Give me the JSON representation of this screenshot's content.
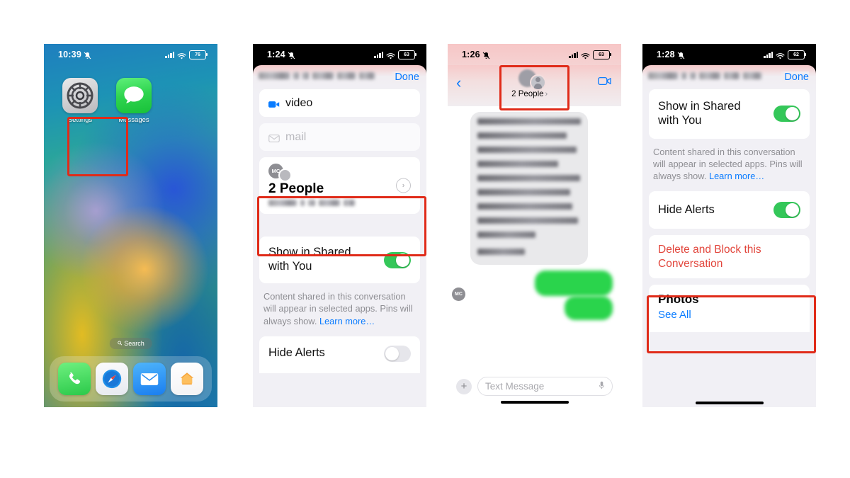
{
  "panels": [
    {
      "id": "home-screen",
      "status": {
        "time": "10:39",
        "battery": "76",
        "mute_icon": "bell-slash-icon",
        "signal_icon": "cellular-bars-icon",
        "wifi_icon": "wifi-icon"
      },
      "apps": [
        {
          "name": "Settings",
          "icon": "settings-gear-icon"
        },
        {
          "name": "Messages",
          "icon": "messages-bubble-icon",
          "highlighted": true
        }
      ],
      "search_pill": {
        "label": "Search",
        "icon": "search-icon"
      },
      "dock": [
        {
          "name": "Phone",
          "icon": "phone-icon"
        },
        {
          "name": "Safari",
          "icon": "safari-compass-icon"
        },
        {
          "name": "Mail",
          "icon": "mail-envelope-icon"
        },
        {
          "name": "Home",
          "icon": "home-house-icon"
        }
      ]
    },
    {
      "id": "contact-details",
      "status": {
        "time": "1:24",
        "battery": "63"
      },
      "done_label": "Done",
      "redacted_title": "Melissa · +1 (346) 870-8495",
      "rows": [
        {
          "label": "video",
          "icon": "video-camera-icon",
          "enabled": true
        },
        {
          "label": "mail",
          "icon": "mail-envelope-icon",
          "enabled": false
        }
      ],
      "people": {
        "avatar_initials": "MC",
        "title": "2 People",
        "subtitle_redacted": "Melissa , +1 (346) 87…",
        "chevron_icon": "chevron-right-icon",
        "highlighted": true
      },
      "shared": {
        "label": "Show in Shared with You",
        "toggle": "on",
        "helper_text": "Content shared in this conversation will appear in selected apps. Pins will always show. ",
        "helper_link": "Learn more…"
      },
      "hide_alerts": {
        "label": "Hide Alerts",
        "toggle": "off"
      }
    },
    {
      "id": "conversation",
      "status": {
        "time": "1:26",
        "battery": "63"
      },
      "back_icon": "chevron-left-icon",
      "header": {
        "title": "2 People",
        "chevron_icon": "chevron-right-icon",
        "avatar_icon": "group-avatar-icon",
        "highlighted": true
      },
      "facetime_icon": "video-camera-icon",
      "received_avatar_initials": "MC",
      "received_message_lines": 10,
      "sent_bubbles": 2,
      "composer": {
        "plus_icon": "plus-icon",
        "placeholder": "Text Message",
        "mic_icon": "microphone-icon"
      }
    },
    {
      "id": "details-scrolled",
      "status": {
        "time": "1:28",
        "battery": "62"
      },
      "done_label": "Done",
      "redacted_title": "Melissa · +1 (346) 870-8495",
      "shared": {
        "label": "Show in Shared with You",
        "toggle": "on",
        "helper_text": "Content shared in this conversation will appear in selected apps. Pins will always show. ",
        "helper_link": "Learn more…"
      },
      "hide_alerts": {
        "label": "Hide Alerts",
        "toggle": "on"
      },
      "delete_block": {
        "label": "Delete and Block this Conversation",
        "highlighted": true
      },
      "photos": {
        "heading": "Photos",
        "see_all": "See All"
      }
    }
  ],
  "colors": {
    "highlight_box": "#e02b19",
    "ios_blue": "#0a7cff",
    "toggle_on": "#34c759",
    "danger_red": "#e2463c",
    "bubble_green": "#2ad44c"
  }
}
